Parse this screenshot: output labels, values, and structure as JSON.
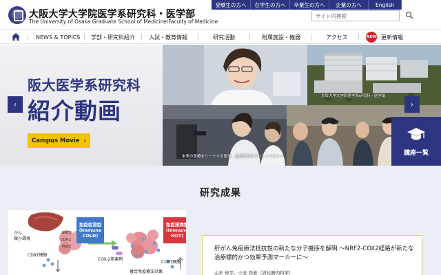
{
  "header": {
    "logo_jp": "大阪大学大学院医学系研究科・医学部",
    "logo_en": "The University of Osaka Graduate School of Medicine/Faculty of Medicine",
    "audience_links": [
      "受験生の方へ",
      "在学生の方へ",
      "卒業生の方へ",
      "企業の方へ",
      "English"
    ],
    "search_placeholder": "サイト内検索"
  },
  "nav": {
    "items": [
      "NEWS & TOPICS",
      "学部・研究科紹介",
      "入試・教育情報",
      "研究活動",
      "附属施設・機器",
      "アクセス",
      "更新情報"
    ],
    "new_badge": "NEW"
  },
  "hero": {
    "title_line1": "阪大医学系研究科",
    "title_line2": "紹介動画",
    "button_label": "Campus Movie",
    "button_arrow": "›",
    "caption_campus": "大阪大学大学院医学系研究科・医学部",
    "caption_lab": "未来の医療をリードする医学、医療研究のスペシャリストへ",
    "prev_arrow": "‹",
    "next_arrow": "›"
  },
  "lecture_tab": {
    "label": "講座一覧"
  },
  "research": {
    "section_title": "研究成果",
    "figure": {
      "micro_env": "がん\n微小環境",
      "cold_label": "免疫枯渇型\n(Immune\nCOLD)",
      "hot_label": "免疫浸潤型\n(Immune\nHOT)",
      "nrf2": "NRF2",
      "cox2": "COX-2",
      "pge2": "PGE2",
      "cd8t": "CD8T細胞",
      "inhibitor": "COX-2阻害剤",
      "combo": "複合免疫療法効果"
    },
    "article": {
      "title": "肝がん免疫療法抵抗性の新たな分子機序を解明 〜NRF2-COX2経路が新たな治療標的かつ効果予測マーカーに〜",
      "authors": "山本 修平、小玉 尚宏（消化器内科学）"
    }
  },
  "colors": {
    "brand": "#2d3580",
    "accent": "#f3c300",
    "badge": "#d9202c",
    "research_bg": "#eceef5"
  }
}
